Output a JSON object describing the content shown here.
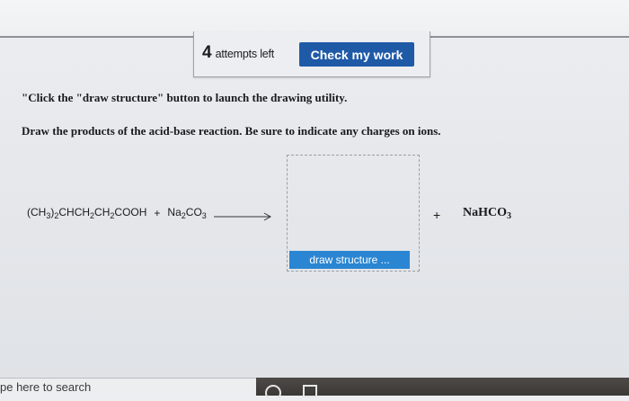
{
  "header": {
    "attempts_count": "4",
    "attempts_label": "attempts left",
    "check_button": "Check my work"
  },
  "instructions": {
    "line1": "\"Click the \"draw structure\" button to launch the drawing utility.",
    "line2": "Draw the products of the acid-base reaction. Be sure to indicate any charges on ions."
  },
  "reaction": {
    "reactant1": {
      "parts": [
        "(CH",
        "3",
        ")",
        "2",
        "CHCH",
        "2",
        "CH",
        "2",
        "COOH"
      ]
    },
    "plus1": "+",
    "reactant2": {
      "parts": [
        "Na",
        "2",
        "CO",
        "3"
      ]
    },
    "plus2": "+",
    "product2": {
      "parts": [
        "NaHCO",
        "3"
      ]
    }
  },
  "draw_button": "draw structure ...",
  "taskbar": {
    "search_placeholder": "pe here to search"
  },
  "colors": {
    "check_button_bg": "#1f5aa7",
    "draw_button_bg": "#2a86d2"
  }
}
